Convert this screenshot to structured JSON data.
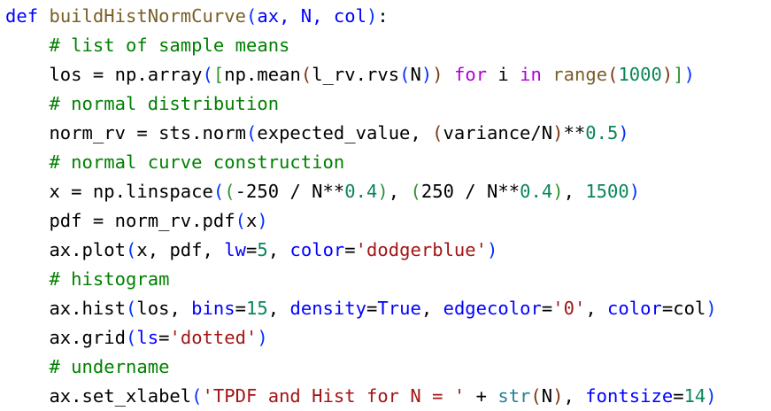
{
  "colors": {
    "background": "#ffffff",
    "default": "#000000",
    "keyword": "#0000ff",
    "function": "#795e26",
    "comment": "#008000",
    "string": "#a31515",
    "number": "#098658",
    "builtin": "#267f99",
    "control": "#af00db",
    "bracket_level1": "#0431fa",
    "bracket_level2": "#319331",
    "bracket_level3": "#7b3814"
  },
  "lines": [
    [
      {
        "t": "def ",
        "c": "keyword"
      },
      {
        "t": "buildHistNormCurve",
        "c": "function"
      },
      {
        "t": "(",
        "c": "bracket_level1"
      },
      {
        "t": "ax, N, col",
        "c": "keyword"
      },
      {
        "t": ")",
        "c": "bracket_level1"
      },
      {
        "t": ":",
        "c": "default"
      }
    ],
    [
      {
        "t": "    # list of sample means",
        "c": "comment"
      }
    ],
    [
      {
        "t": "    los = np.array",
        "c": "default"
      },
      {
        "t": "(",
        "c": "bracket_level1"
      },
      {
        "t": "[",
        "c": "bracket_level2"
      },
      {
        "t": "np.mean",
        "c": "default"
      },
      {
        "t": "(",
        "c": "bracket_level3"
      },
      {
        "t": "l_rv.rvs",
        "c": "default"
      },
      {
        "t": "(",
        "c": "bracket_level1"
      },
      {
        "t": "N",
        "c": "default"
      },
      {
        "t": ")",
        "c": "bracket_level1"
      },
      {
        "t": ")",
        "c": "bracket_level3"
      },
      {
        "t": " for ",
        "c": "control"
      },
      {
        "t": "i ",
        "c": "default"
      },
      {
        "t": "in ",
        "c": "control"
      },
      {
        "t": "range",
        "c": "function"
      },
      {
        "t": "(",
        "c": "bracket_level3"
      },
      {
        "t": "1000",
        "c": "number"
      },
      {
        "t": ")",
        "c": "bracket_level3"
      },
      {
        "t": "]",
        "c": "bracket_level2"
      },
      {
        "t": ")",
        "c": "bracket_level1"
      }
    ],
    [
      {
        "t": "    # normal distribution",
        "c": "comment"
      }
    ],
    [
      {
        "t": "    norm_rv = sts.norm",
        "c": "default"
      },
      {
        "t": "(",
        "c": "bracket_level1"
      },
      {
        "t": "expected_value, ",
        "c": "default"
      },
      {
        "t": "(",
        "c": "bracket_level3"
      },
      {
        "t": "variance/N",
        "c": "default"
      },
      {
        "t": ")",
        "c": "bracket_level3"
      },
      {
        "t": "**",
        "c": "default"
      },
      {
        "t": "0.5",
        "c": "number"
      },
      {
        "t": ")",
        "c": "bracket_level1"
      }
    ],
    [
      {
        "t": "    # normal curve construction",
        "c": "comment"
      }
    ],
    [
      {
        "t": "    x = np.linspace",
        "c": "default"
      },
      {
        "t": "(",
        "c": "bracket_level1"
      },
      {
        "t": "(",
        "c": "bracket_level2"
      },
      {
        "t": "-250 / N**",
        "c": "default"
      },
      {
        "t": "0.4",
        "c": "number"
      },
      {
        "t": ")",
        "c": "bracket_level2"
      },
      {
        "t": ", ",
        "c": "default"
      },
      {
        "t": "(",
        "c": "bracket_level2"
      },
      {
        "t": "250 / N**",
        "c": "default"
      },
      {
        "t": "0.4",
        "c": "number"
      },
      {
        "t": ")",
        "c": "bracket_level2"
      },
      {
        "t": ", ",
        "c": "default"
      },
      {
        "t": "1500",
        "c": "number"
      },
      {
        "t": ")",
        "c": "bracket_level1"
      }
    ],
    [
      {
        "t": "    pdf = norm_rv.pdf",
        "c": "default"
      },
      {
        "t": "(",
        "c": "bracket_level1"
      },
      {
        "t": "x",
        "c": "default"
      },
      {
        "t": ")",
        "c": "bracket_level1"
      }
    ],
    [
      {
        "t": "    ax.plot",
        "c": "default"
      },
      {
        "t": "(",
        "c": "bracket_level1"
      },
      {
        "t": "x, pdf, ",
        "c": "default"
      },
      {
        "t": "lw",
        "c": "keyword"
      },
      {
        "t": "=",
        "c": "default"
      },
      {
        "t": "5",
        "c": "number"
      },
      {
        "t": ", ",
        "c": "default"
      },
      {
        "t": "color",
        "c": "keyword"
      },
      {
        "t": "=",
        "c": "default"
      },
      {
        "t": "'dodgerblue'",
        "c": "string"
      },
      {
        "t": ")",
        "c": "bracket_level1"
      }
    ],
    [
      {
        "t": "    # histogram",
        "c": "comment"
      }
    ],
    [
      {
        "t": "    ax.hist",
        "c": "default"
      },
      {
        "t": "(",
        "c": "bracket_level1"
      },
      {
        "t": "los, ",
        "c": "default"
      },
      {
        "t": "bins",
        "c": "keyword"
      },
      {
        "t": "=",
        "c": "default"
      },
      {
        "t": "15",
        "c": "number"
      },
      {
        "t": ", ",
        "c": "default"
      },
      {
        "t": "density",
        "c": "keyword"
      },
      {
        "t": "=",
        "c": "default"
      },
      {
        "t": "True",
        "c": "keyword"
      },
      {
        "t": ", ",
        "c": "default"
      },
      {
        "t": "edgecolor",
        "c": "keyword"
      },
      {
        "t": "=",
        "c": "default"
      },
      {
        "t": "'0'",
        "c": "string"
      },
      {
        "t": ", ",
        "c": "default"
      },
      {
        "t": "color",
        "c": "keyword"
      },
      {
        "t": "=col",
        "c": "default"
      },
      {
        "t": ")",
        "c": "bracket_level1"
      }
    ],
    [
      {
        "t": "    ax.grid",
        "c": "default"
      },
      {
        "t": "(",
        "c": "bracket_level1"
      },
      {
        "t": "ls",
        "c": "keyword"
      },
      {
        "t": "=",
        "c": "default"
      },
      {
        "t": "'dotted'",
        "c": "string"
      },
      {
        "t": ")",
        "c": "bracket_level1"
      }
    ],
    [
      {
        "t": "    # undername",
        "c": "comment"
      }
    ],
    [
      {
        "t": "    ax.set_xlabel",
        "c": "default"
      },
      {
        "t": "(",
        "c": "bracket_level1"
      },
      {
        "t": "'TPDF and Hist for N = '",
        "c": "string"
      },
      {
        "t": " + ",
        "c": "default"
      },
      {
        "t": "str",
        "c": "builtin"
      },
      {
        "t": "(",
        "c": "bracket_level3"
      },
      {
        "t": "N",
        "c": "default"
      },
      {
        "t": ")",
        "c": "bracket_level3"
      },
      {
        "t": ", ",
        "c": "default"
      },
      {
        "t": "fontsize",
        "c": "keyword"
      },
      {
        "t": "=",
        "c": "default"
      },
      {
        "t": "14",
        "c": "number"
      },
      {
        "t": ")",
        "c": "bracket_level1"
      }
    ]
  ]
}
